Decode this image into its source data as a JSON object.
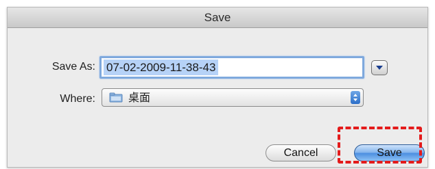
{
  "dialog": {
    "title": "Save",
    "save_as_label": "Save As:",
    "filename": "07-02-2009-11-38-43",
    "where_label": "Where:",
    "where_value": "桌面",
    "cancel_label": "Cancel",
    "save_label": "Save"
  },
  "icons": {
    "disclosure": "chevron-down-icon",
    "location": "folder-icon",
    "popup": "stepper-icon"
  },
  "colors": {
    "highlight": "#e31b1b",
    "focus_ring": "#7fa9dd",
    "default_button": "#4a8de0"
  }
}
